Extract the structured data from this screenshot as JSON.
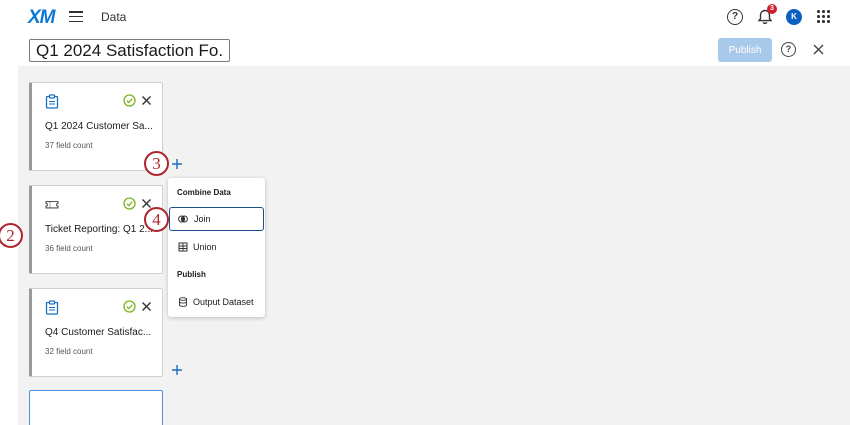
{
  "nav": {
    "logo": "XM",
    "section_title": "Data",
    "notification_count": "3",
    "avatar_initial": "K"
  },
  "header": {
    "dataset_title": "Q1 2024 Satisfaction Fo...",
    "publish_label": "Publish"
  },
  "cards": [
    {
      "name": "Q1 2024 Customer Sa...",
      "count": "37 field count",
      "icon": "clipboard-icon"
    },
    {
      "name": "Ticket Reporting: Q1 2...",
      "count": "36 field count",
      "icon": "ticket-icon"
    },
    {
      "name": "Q4 Customer Satisfac...",
      "count": "32 field count",
      "icon": "clipboard-icon"
    }
  ],
  "menu": {
    "combine_heading": "Combine Data",
    "join_label": "Join",
    "union_label": "Union",
    "publish_heading": "Publish",
    "output_label": "Output Dataset"
  },
  "steps": [
    "2",
    "3",
    "4"
  ],
  "colors": {
    "brand": "#0a78d4",
    "publish_disabled": "#a9c9ea",
    "step_badge": "#b0262e",
    "check": "#7ab51d",
    "selected_outline": "#1f4e8c"
  }
}
